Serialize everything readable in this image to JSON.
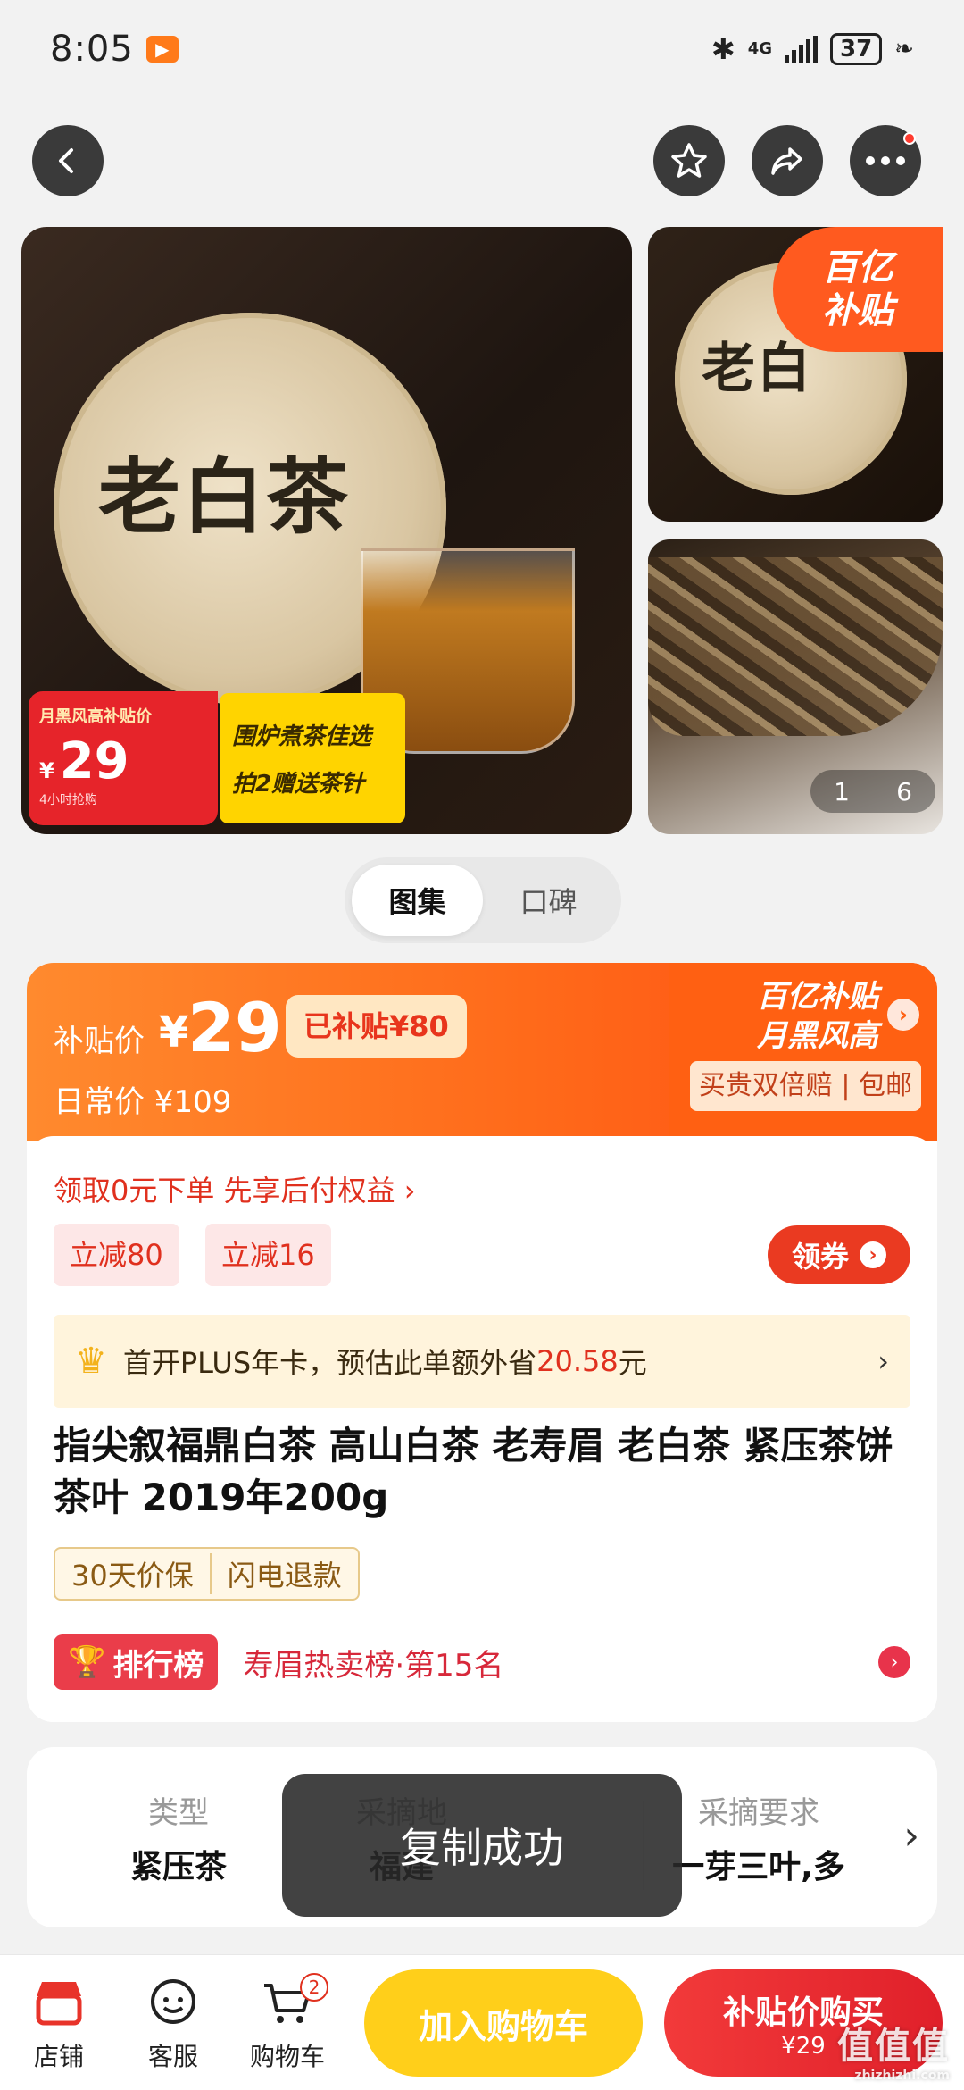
{
  "status_bar": {
    "time": "8:05",
    "app_icon": "▶",
    "network": "4G",
    "battery": "37"
  },
  "gallery": {
    "main_cake_text": "老白茶",
    "side_cake_text": "老白",
    "price_tag_title": "月黑风高补贴价",
    "price_tag_currency": "¥",
    "price_tag_price": "29",
    "price_tag_note": "4小时抢购",
    "slogan_line1": "围炉煮茶佳选",
    "slogan_line2": "拍2赠送茶针",
    "corner_line1": "百亿",
    "corner_line2": "补贴",
    "counter_current": "1",
    "counter_total": "6"
  },
  "tabs": [
    {
      "label": "图集",
      "active": true
    },
    {
      "label": "口碑",
      "active": false
    }
  ],
  "price_banner": {
    "label": "补贴价",
    "currency": "¥",
    "price": "29",
    "saved": "已补贴¥80",
    "daily_price": "日常价 ¥109",
    "brand_line1": "百亿补贴",
    "brand_line2": "月黑风高",
    "guarantee": "买贵双倍赔 | 包邮"
  },
  "offers": {
    "prepay": "领取0元下单 先享后付权益 ›",
    "coupons": [
      "立减80",
      "立减16"
    ],
    "get_coupon": "领券"
  },
  "plus": {
    "text_before": "首开PLUS年卡，预估此单额外省",
    "amount": "20.58",
    "text_after": "元",
    "arrow": "›"
  },
  "product": {
    "title": "指尖叙福鼎白茶 高山白茶 老寿眉 老白茶 紧压茶饼茶叶 2019年200g",
    "tags": [
      "30天价保",
      "闪电退款"
    ],
    "rank_badge": "排行榜",
    "rank_text": "寿眉热卖榜·第15名"
  },
  "attributes": [
    {
      "key": "类型",
      "value": "紧压茶"
    },
    {
      "key": "采摘地",
      "value": "福建"
    },
    {
      "key": "采摘要求",
      "value": "一芽三叶,多"
    }
  ],
  "toast": "复制成功",
  "bottom_bar": {
    "store": "店铺",
    "service": "客服",
    "cart": "购物车",
    "cart_count": "2",
    "add_to_cart": "加入购物车",
    "buy_line1": "补贴价购买",
    "buy_line2": "¥29"
  },
  "watermark": {
    "main": "值值值",
    "sub": "zhizhizhi.com"
  },
  "colors": {
    "accent_orange": "#ff6a1a",
    "accent_red": "#e0301e",
    "cart_yellow": "#ffcf1a"
  }
}
